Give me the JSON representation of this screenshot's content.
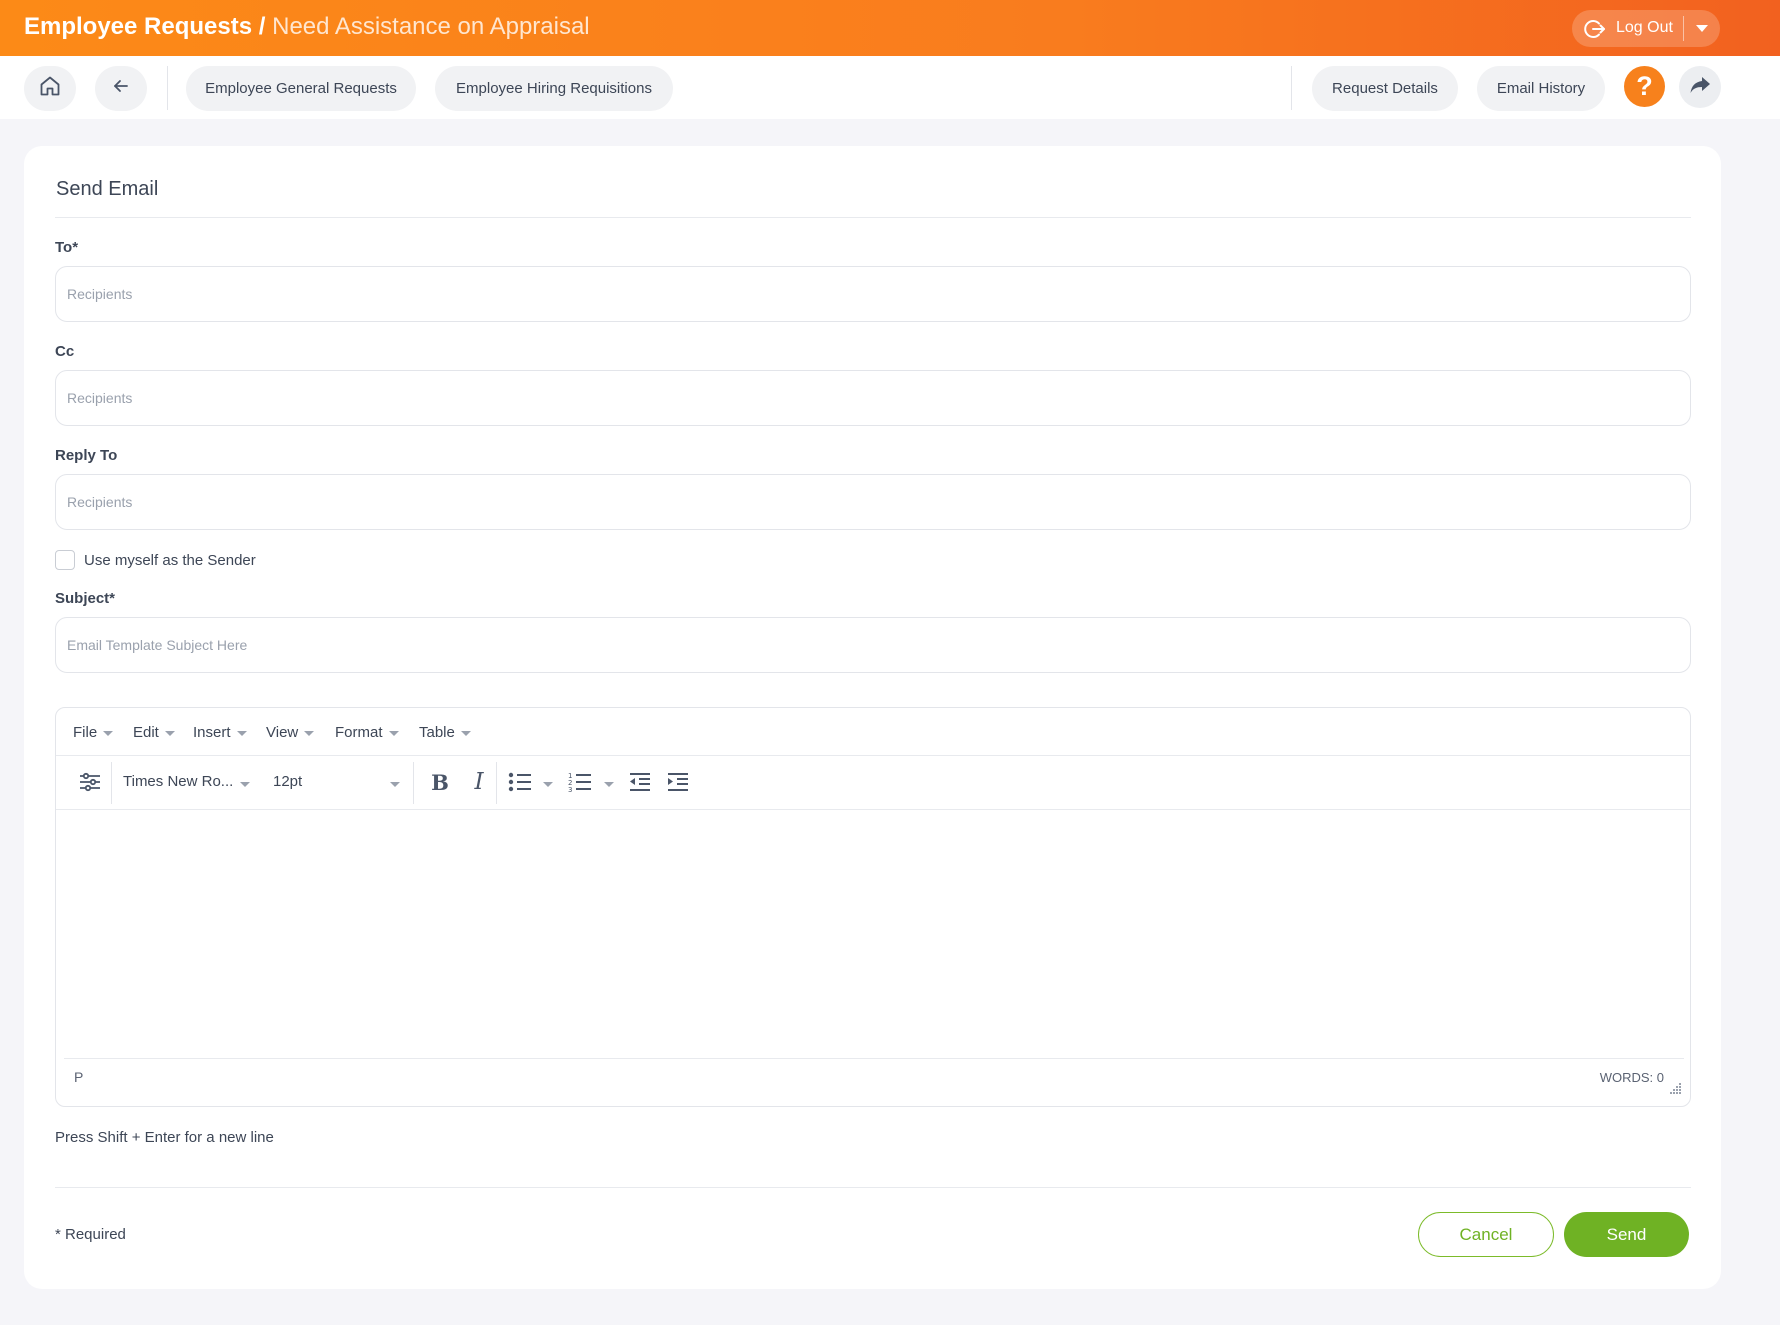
{
  "header": {
    "title": "Employee Requests",
    "separator": "/",
    "subtitle": "Need Assistance on Appraisal",
    "logout_label": "Log Out"
  },
  "nav": {
    "home_icon": "home-icon",
    "back_icon": "arrow-left-icon",
    "left_tabs": [
      "Employee General Requests",
      "Employee Hiring Requisitions"
    ],
    "right_tabs": [
      "Request Details",
      "Email History"
    ],
    "help_label": "?",
    "share_icon": "share-icon"
  },
  "form": {
    "title": "Send Email",
    "to_label": "To*",
    "to_placeholder": "Recipients",
    "cc_label": "Cc",
    "cc_placeholder": "Recipients",
    "reply_to_label": "Reply To",
    "reply_to_placeholder": "Recipients",
    "use_myself_label": "Use myself as the Sender",
    "use_myself_checked": false,
    "subject_label": "Subject*",
    "subject_placeholder": "Email Template Subject Here"
  },
  "editor": {
    "menu": [
      "File",
      "Edit",
      "Insert",
      "View",
      "Format",
      "Table"
    ],
    "font_family": "Times New Ro...",
    "font_size": "12pt",
    "status_path": "P",
    "word_count": "WORDS: 0",
    "tool_icons": [
      "sliders-icon",
      "bold-icon",
      "italic-icon",
      "bullet-list-icon",
      "numbered-list-icon",
      "outdent-icon",
      "indent-icon"
    ]
  },
  "footer": {
    "hint": "Press Shift + Enter for a new line",
    "required_note": "* Required",
    "cancel_label": "Cancel",
    "send_label": "Send"
  },
  "colors": {
    "header_gradient_start": "#fc8a17",
    "header_gradient_end": "#f2611f",
    "help_orange": "#f7811c",
    "send_green": "#6fb224",
    "page_background": "#f5f5f9"
  }
}
